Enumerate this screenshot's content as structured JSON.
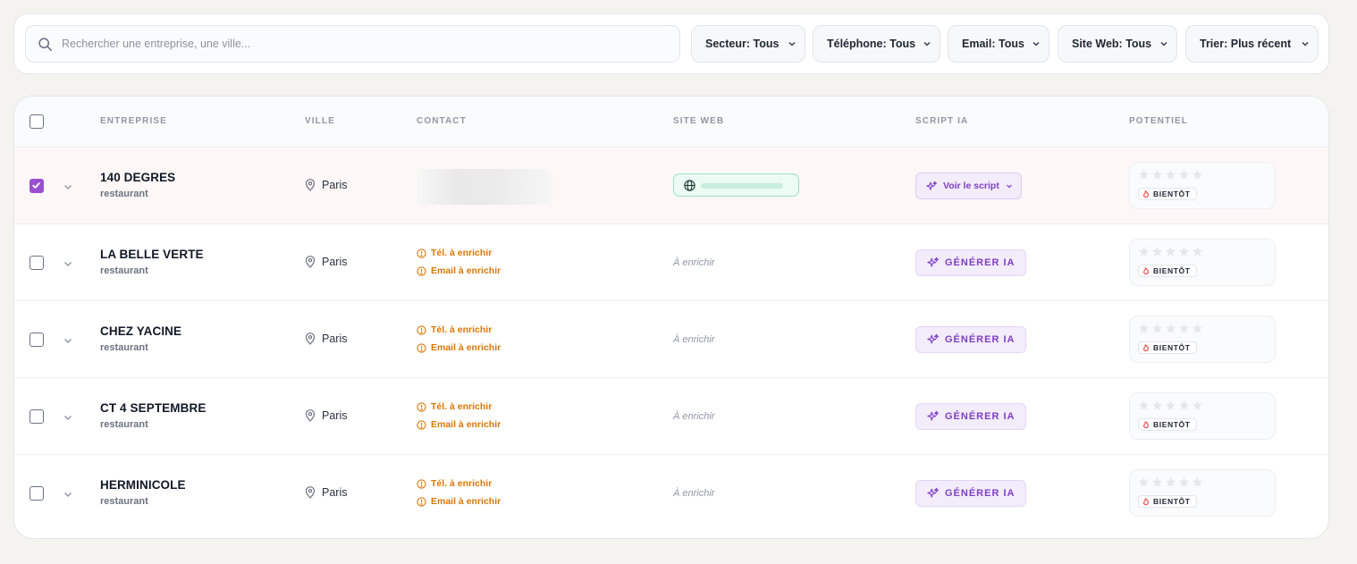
{
  "search": {
    "placeholder": "Rechercher une entreprise, une ville..."
  },
  "filters": [
    {
      "label": "Secteur: Tous"
    },
    {
      "label": "Téléphone: Tous"
    },
    {
      "label": "Email: Tous"
    },
    {
      "label": "Site Web: Tous"
    },
    {
      "label": "Trier: Plus récent"
    }
  ],
  "table": {
    "headers": {
      "entreprise": "ENTREPRISE",
      "ville": "VILLE",
      "contact": "CONTACT",
      "site_web": "SITE WEB",
      "script_ia": "SCRIPT IA",
      "potentiel": "POTENTIEL"
    },
    "rows": [
      {
        "name": "140 DEGRES",
        "sector": "restaurant",
        "city": "Paris",
        "selected": true,
        "script_label": "Voir le script",
        "soon_label": "BIENTÔT"
      },
      {
        "name": "LA BELLE VERTE",
        "sector": "restaurant",
        "city": "Paris",
        "selected": false,
        "tel": "Tél. à enrichir",
        "email": "Email à enrichir",
        "site": "À enrichir",
        "generate_label": "GÉNÉRER IA",
        "soon_label": "BIENTÔT"
      },
      {
        "name": "CHEZ YACINE",
        "sector": "restaurant",
        "city": "Paris",
        "selected": false,
        "tel": "Tél. à enrichir",
        "email": "Email à enrichir",
        "site": "À enrichir",
        "generate_label": "GÉNÉRER IA",
        "soon_label": "BIENTÔT"
      },
      {
        "name": "CT 4 SEPTEMBRE",
        "sector": "restaurant",
        "city": "Paris",
        "selected": false,
        "tel": "Tél. à enrichir",
        "email": "Email à enrichir",
        "site": "À enrichir",
        "generate_label": "GÉNÉRER IA",
        "soon_label": "BIENTÔT"
      },
      {
        "name": "HERMINICOLE",
        "sector": "restaurant",
        "city": "Paris",
        "selected": false,
        "tel": "Tél. à enrichir",
        "email": "Email à enrichir",
        "site": "À enrichir",
        "generate_label": "GÉNÉRER IA",
        "soon_label": "BIENTÔT"
      }
    ]
  },
  "colors": {
    "accent": "#9b4fd0",
    "accent_text": "#7e3fc6",
    "warning": "#d97706",
    "site_chip_border": "#9fe0c4",
    "selected_row_bg": "#fdf8f7"
  },
  "icons": [
    "search-icon",
    "chevron-down-icon",
    "map-pin-icon",
    "alert-circle-icon",
    "globe-icon",
    "sparkles-icon",
    "star-icon",
    "flame-icon",
    "check-icon"
  ]
}
